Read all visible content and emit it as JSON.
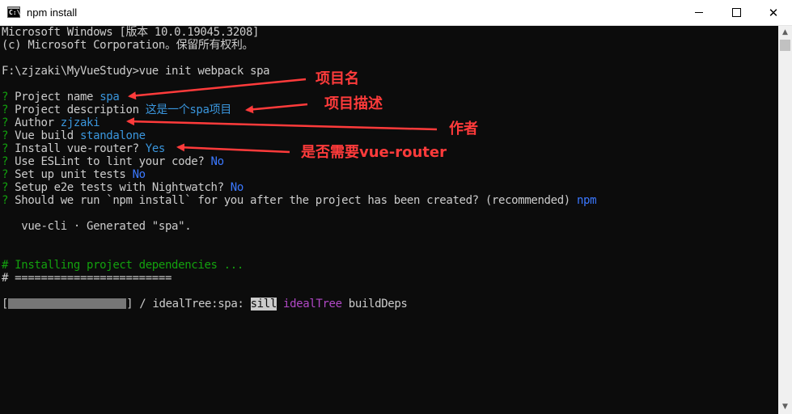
{
  "window": {
    "title": "npm install",
    "app_icon_text": "C:\\",
    "controls": {
      "minimize": "minimize",
      "maximize": "maximize",
      "close": "✕"
    }
  },
  "console": {
    "lines": {
      "l1": "Microsoft Windows [版本 10.0.19045.3208]",
      "l2": "(c) Microsoft Corporation。保留所有权利。",
      "l3": "F:\\zjzaki\\MyVueStudy>vue init webpack spa",
      "q_mark": "?",
      "q1_label": " Project name ",
      "q1_value": "spa",
      "q2_label": " Project description ",
      "q2_value": "这是一个spa项目",
      "q3_label": " Author ",
      "q3_value": "zjzaki",
      "q4_label": " Vue build ",
      "q4_value": "standalone",
      "q5_label": " Install vue-router? ",
      "q5_value": "Yes",
      "q6_label": " Use ESLint to lint your code? ",
      "q6_value": "No",
      "q7_label": " Set up unit tests ",
      "q7_value": "No",
      "q8_label": " Setup e2e tests with Nightwatch? ",
      "q8_value": "No",
      "q9_label": " Should we run `npm install` for you after the project has been created? (recommended) ",
      "q9_value": "npm",
      "generated": "   vue-cli · Generated \"spa\".",
      "installing": "# Installing project dependencies ...",
      "separator": "# ========================",
      "prog_open": "[",
      "prog_close": "] / idealTree:spa: ",
      "prog_sill": "sill",
      "prog_ideal": " idealTree",
      "prog_build": " buildDeps"
    }
  },
  "annotations": {
    "project_name": "项目名",
    "project_description": "项目描述",
    "author": "作者",
    "router": "是否需要vue-router"
  },
  "colors": {
    "background": "#0c0c0c",
    "text": "#cccccc",
    "prompt_green": "#13a10e",
    "answer_blue": "#3b78ff",
    "annotation_red": "#ff3b3b",
    "magenta": "#b148c6"
  },
  "icons": {
    "app": "cmd-icon",
    "scroll_up": "chevron-up-icon",
    "scroll_down": "chevron-down-icon"
  }
}
